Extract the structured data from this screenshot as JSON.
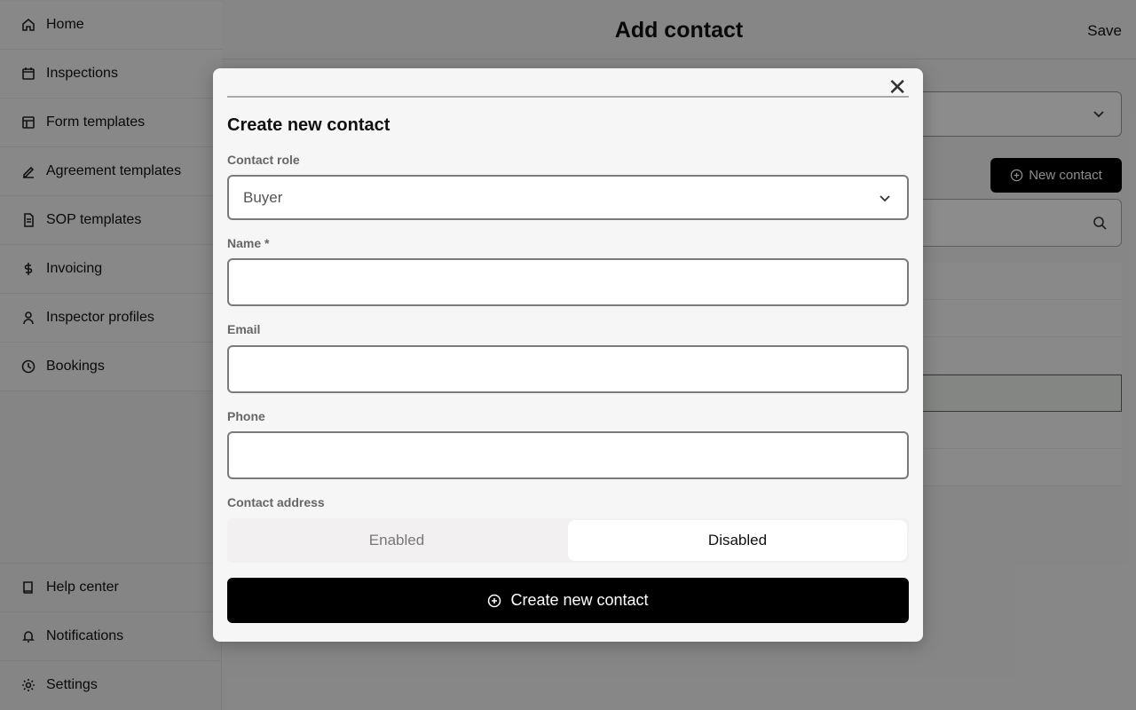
{
  "sidebar": {
    "top_items": [
      {
        "label": "Home",
        "icon": "home-icon"
      },
      {
        "label": "Inspections",
        "icon": "calendar-icon"
      },
      {
        "label": "Form templates",
        "icon": "layout-icon"
      },
      {
        "label": "Agreement templates",
        "icon": "signature-icon"
      },
      {
        "label": "SOP templates",
        "icon": "document-icon"
      },
      {
        "label": "Invoicing",
        "icon": "dollar-icon"
      },
      {
        "label": "Inspector profiles",
        "icon": "user-icon"
      },
      {
        "label": "Bookings",
        "icon": "clock-icon"
      }
    ],
    "bottom_items": [
      {
        "label": "Help center",
        "icon": "book-icon"
      },
      {
        "label": "Notifications",
        "icon": "bell-icon"
      },
      {
        "label": "Settings",
        "icon": "gear-icon"
      }
    ]
  },
  "header": {
    "title": "Add contact",
    "save_label": "Save"
  },
  "background": {
    "new_contact_label": "New contact"
  },
  "modal": {
    "title": "Create new contact",
    "contact_role_label": "Contact role",
    "contact_role_value": "Buyer",
    "name_label": "Name *",
    "name_value": "",
    "email_label": "Email",
    "email_value": "",
    "phone_label": "Phone",
    "phone_value": "",
    "address_label": "Contact address",
    "address_options": [
      "Enabled",
      "Disabled"
    ],
    "address_selected": "Disabled",
    "submit_label": "Create new contact"
  }
}
